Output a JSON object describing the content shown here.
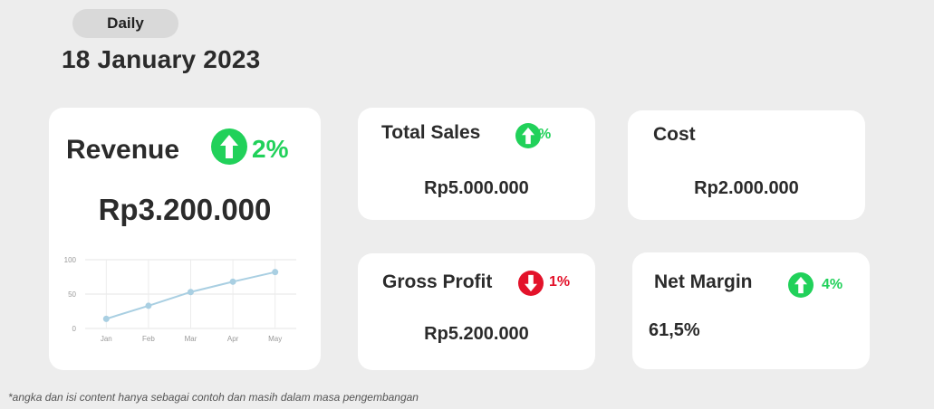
{
  "period_label": "Daily",
  "date": "18 January 2023",
  "colors": {
    "up": "#21d15a",
    "down": "#e3122a",
    "line": "#a9cfe2"
  },
  "revenue": {
    "title": "Revenue",
    "trend": "up",
    "change": "2%",
    "value": "Rp3.200.000"
  },
  "total_sales": {
    "title": "Total Sales",
    "trend": "up",
    "change": "%",
    "value": "Rp5.000.000"
  },
  "cost": {
    "title": "Cost",
    "value": "Rp2.000.000"
  },
  "gross_profit": {
    "title": "Gross Profit",
    "trend": "down",
    "change": "1%",
    "value": "Rp5.200.000"
  },
  "net_margin": {
    "title": "Net Margin",
    "trend": "up",
    "change": "4%",
    "value": "61,5%"
  },
  "chart_data": {
    "type": "line",
    "categories": [
      "Jan",
      "Feb",
      "Mar",
      "Apr",
      "May"
    ],
    "values": [
      14,
      33,
      53,
      68,
      82
    ],
    "yticks": [
      "0",
      "50",
      "100"
    ],
    "ylim": [
      0,
      100
    ],
    "grid": true
  },
  "footnote": "*angka dan isi content hanya sebagai contoh dan masih dalam masa pengembangan"
}
